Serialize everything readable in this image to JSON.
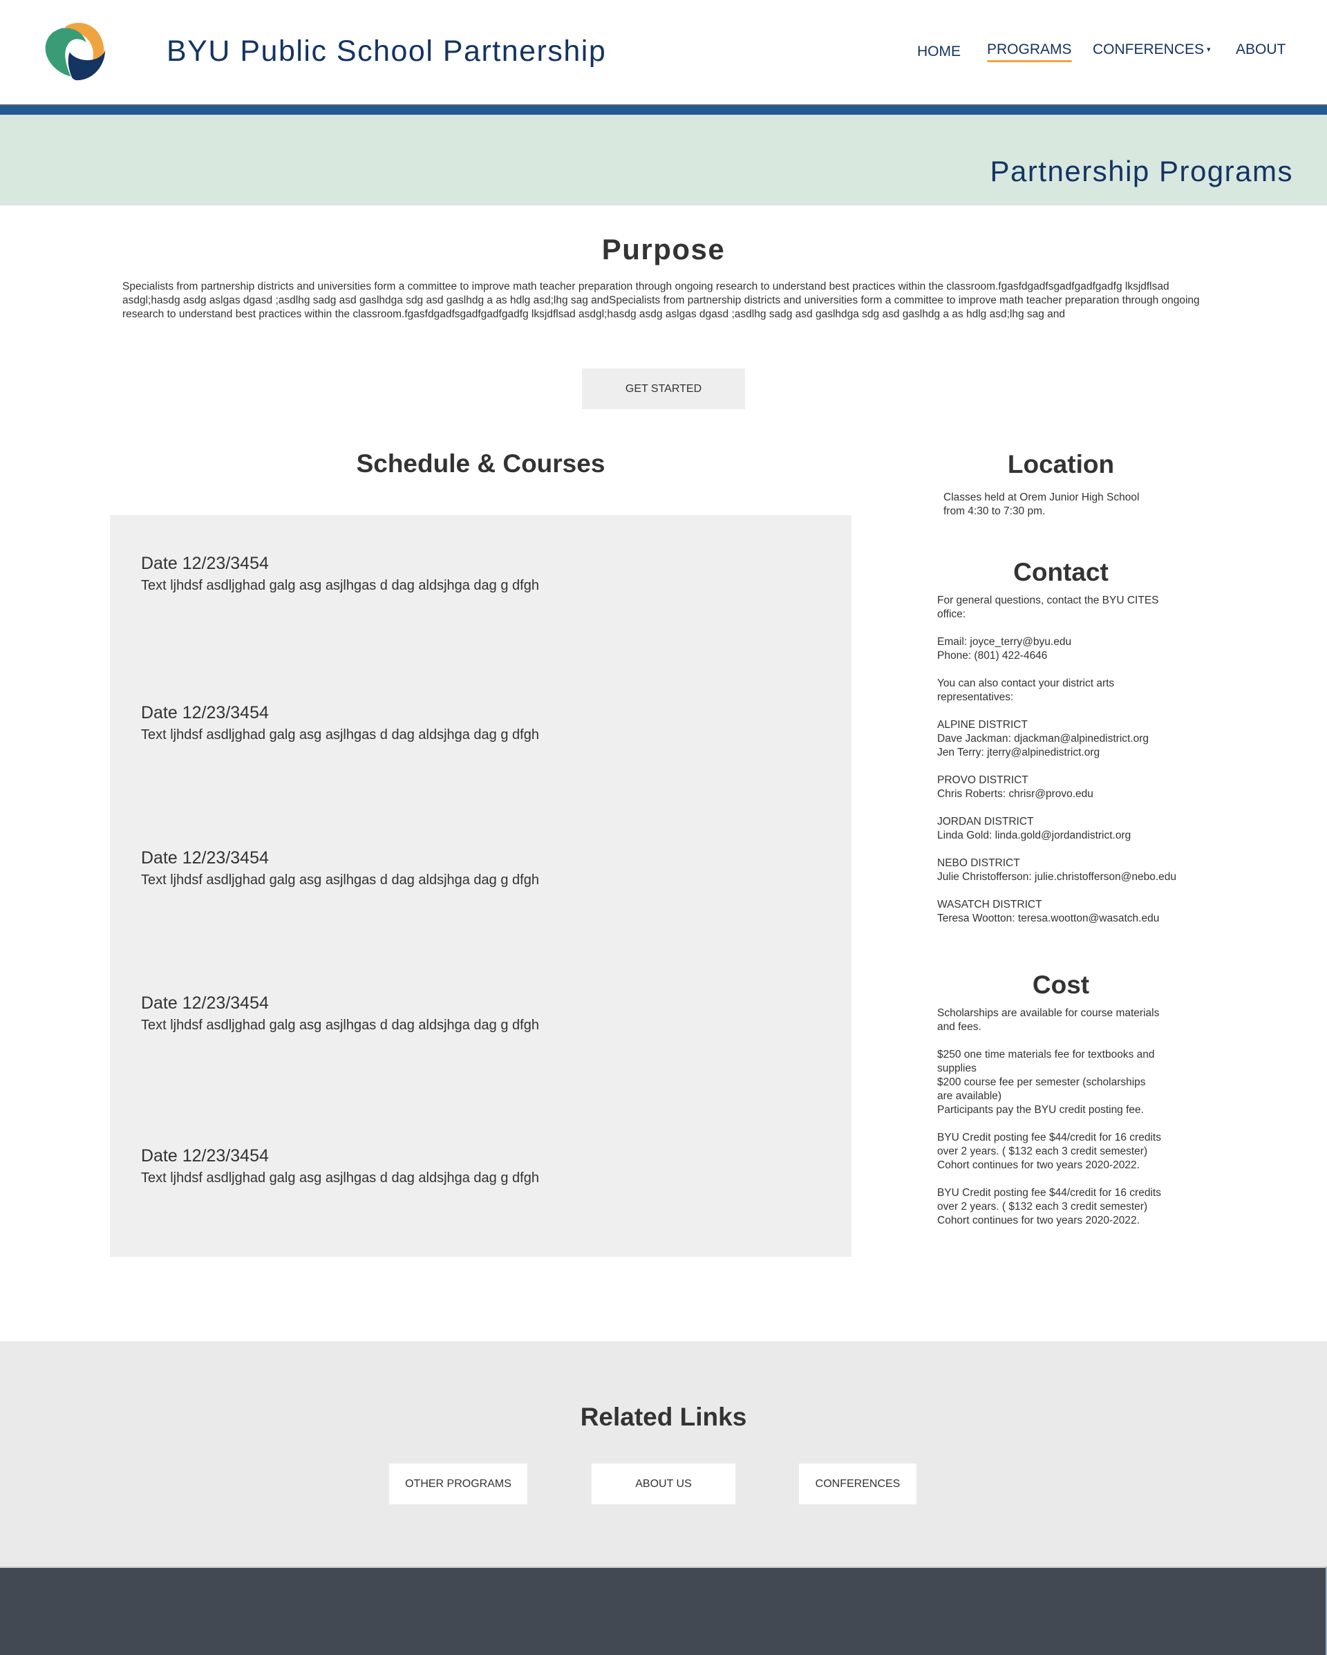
{
  "header": {
    "site_title": "BYU Public School Partnership",
    "logo_icon": "swirl-logo-icon",
    "nav": [
      {
        "label": "HOME",
        "active": false
      },
      {
        "label": "PROGRAMS",
        "active": true
      },
      {
        "label": "CONFERENCES",
        "active": false,
        "dropdown": true,
        "caret": "▾"
      },
      {
        "label": "ABOUT",
        "active": false
      }
    ]
  },
  "colors": {
    "brand_navy": "#143462",
    "brand_orange": "#f0a441",
    "brand_green": "#3a9c77",
    "bar_blue": "#225c93",
    "banner_mint": "#d8e8df",
    "footer_slate": "#424953"
  },
  "banner": {
    "title": "Partnership Programs"
  },
  "purpose": {
    "heading": "Purpose",
    "text": "Specialists from partnership districts and universities form a committee to improve math teacher preparation through ongoing research to understand best practices within the classroom.fgasfdgadfsgadfgadfgadfg lksjdflsad asdgl;hasdg asdg aslgas dgasd ;asdlhg sadg asd gaslhdga sdg asd gaslhdg a as hdlg asd;lhg sag andSpecialists from partnership districts and universities form a committee to improve math teacher preparation through ongoing research to understand best practices within the classroom.fgasfdgadfsgadfgadfgadfg lksjdflsad asdgl;hasdg asdg aslgas dgasd ;asdlhg sadg asd gaslhdga sdg asd gaslhdg a as hdlg asd;lhg sag and",
    "button_label": "GET STARTED"
  },
  "schedule": {
    "heading": "Schedule & Courses",
    "items": [
      {
        "date": "Date 12/23/3454",
        "text": "Text ljhdsf asdljghad galg asg asjlhgas d dag aldsjhga dag g dfgh"
      },
      {
        "date": "Date 12/23/3454",
        "text": "Text ljhdsf asdljghad galg asg asjlhgas d dag aldsjhga dag g dfgh"
      },
      {
        "date": "Date 12/23/3454",
        "text": "Text ljhdsf asdljghad galg asg asjlhgas d dag aldsjhga dag g dfgh"
      },
      {
        "date": "Date 12/23/3454",
        "text": "Text ljhdsf asdljghad galg asg asjlhgas d dag aldsjhga dag g dfgh"
      },
      {
        "date": "Date 12/23/3454",
        "text": "Text ljhdsf asdljghad galg asg asjlhgas d dag aldsjhga dag g dfgh"
      }
    ]
  },
  "location": {
    "heading": "Location",
    "lines": [
      "Classes held at Orem Junior High School",
      "from 4:30 to 7:30 pm."
    ]
  },
  "contact": {
    "heading": "Contact",
    "intro": [
      "For general questions, contact the BYU CITES",
      "office:"
    ],
    "email": "Email: joyce_terry@byu.edu",
    "phone": "Phone: (801) 422-4646",
    "district_intro": [
      "You can also contact your district arts",
      "representatives:"
    ],
    "districts": [
      {
        "name": "ALPINE DISTRICT",
        "contacts": [
          "Dave Jackman: djackman@alpinedistrict.org",
          "Jen Terry: jterry@alpinedistrict.org"
        ]
      },
      {
        "name": "PROVO DISTRICT",
        "contacts": [
          "Chris Roberts: chrisr@provo.edu"
        ]
      },
      {
        "name": "JORDAN DISTRICT",
        "contacts": [
          "Linda Gold: linda.gold@jordandistrict.org"
        ]
      },
      {
        "name": "NEBO DISTRICT",
        "contacts": [
          "Julie Christofferson: julie.christofferson@nebo.edu"
        ]
      },
      {
        "name": "WASATCH DISTRICT",
        "contacts": [
          "Teresa Wootton: teresa.wootton@wasatch.edu"
        ]
      }
    ]
  },
  "cost": {
    "heading": "Cost",
    "lines": [
      [
        "Scholarships are available for course materials",
        "and fees."
      ],
      [
        "$250 one time materials fee for textbooks and",
        "supplies",
        "$200 course fee per semester (scholarships",
        "are available)",
        "Participants pay the BYU credit posting fee."
      ],
      [
        "BYU Credit posting fee $44/credit for 16 credits",
        "over 2 years. ( $132 each 3 credit semester)",
        "Cohort continues for two years 2020-2022."
      ],
      [
        "BYU Credit posting fee $44/credit for 16 credits",
        "over 2 years. ( $132 each 3 credit semester)",
        "Cohort continues for two years 2020-2022."
      ]
    ]
  },
  "related": {
    "heading": "Related Links",
    "buttons": [
      {
        "label": "OTHER PROGRAMS"
      },
      {
        "label": "ABOUT US"
      },
      {
        "label": "CONFERENCES"
      }
    ]
  }
}
